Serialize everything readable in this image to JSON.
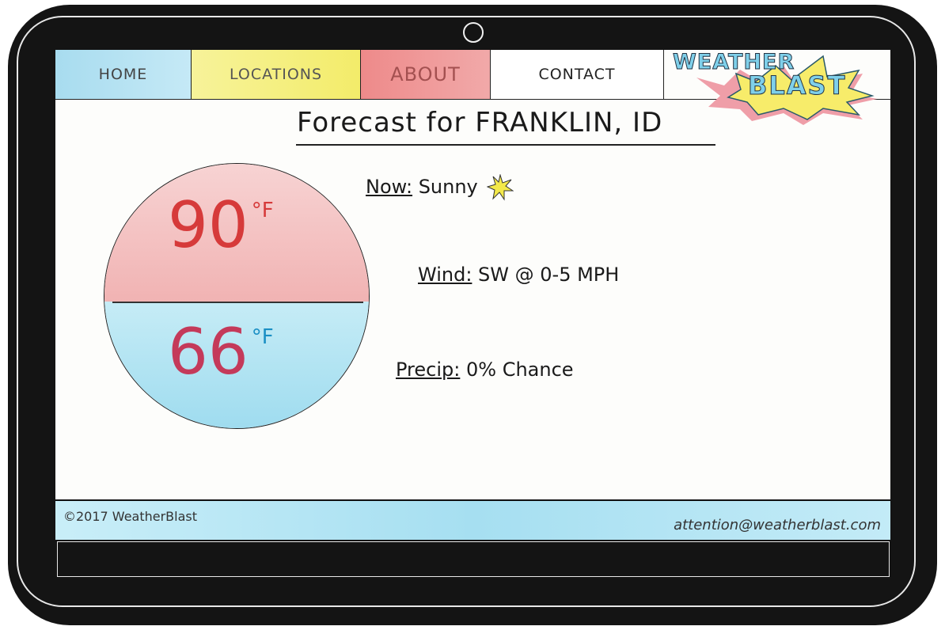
{
  "nav": {
    "items": [
      {
        "label": "HOME",
        "color": "#a8dcef"
      },
      {
        "label": "LOCATIONS",
        "color": "#f5ef7a"
      },
      {
        "label": "ABOUT",
        "color": "#ee8f8f"
      },
      {
        "label": "CONTACT",
        "color": "#ffffff"
      }
    ]
  },
  "logo": {
    "line1": "WEATHER",
    "line2": "BLAST"
  },
  "heading": "Forecast for FRANKLIN, ID",
  "temperature": {
    "high": "90",
    "high_unit": "°F",
    "low": "66",
    "low_unit": "°F"
  },
  "conditions": {
    "now_label": "Now:",
    "now_value": "Sunny",
    "now_icon": "sun-icon",
    "wind_label": "Wind:",
    "wind_value": "SW @ 0-5 MPH",
    "precip_label": "Precip:",
    "precip_value": "0% Chance"
  },
  "footer": {
    "copyright": "©2017 WeatherBlast",
    "email": "attention@weatherblast.com"
  },
  "colors": {
    "high": "#d63a3a",
    "low": "#1a8fc4",
    "footer": "#a6dff1"
  }
}
